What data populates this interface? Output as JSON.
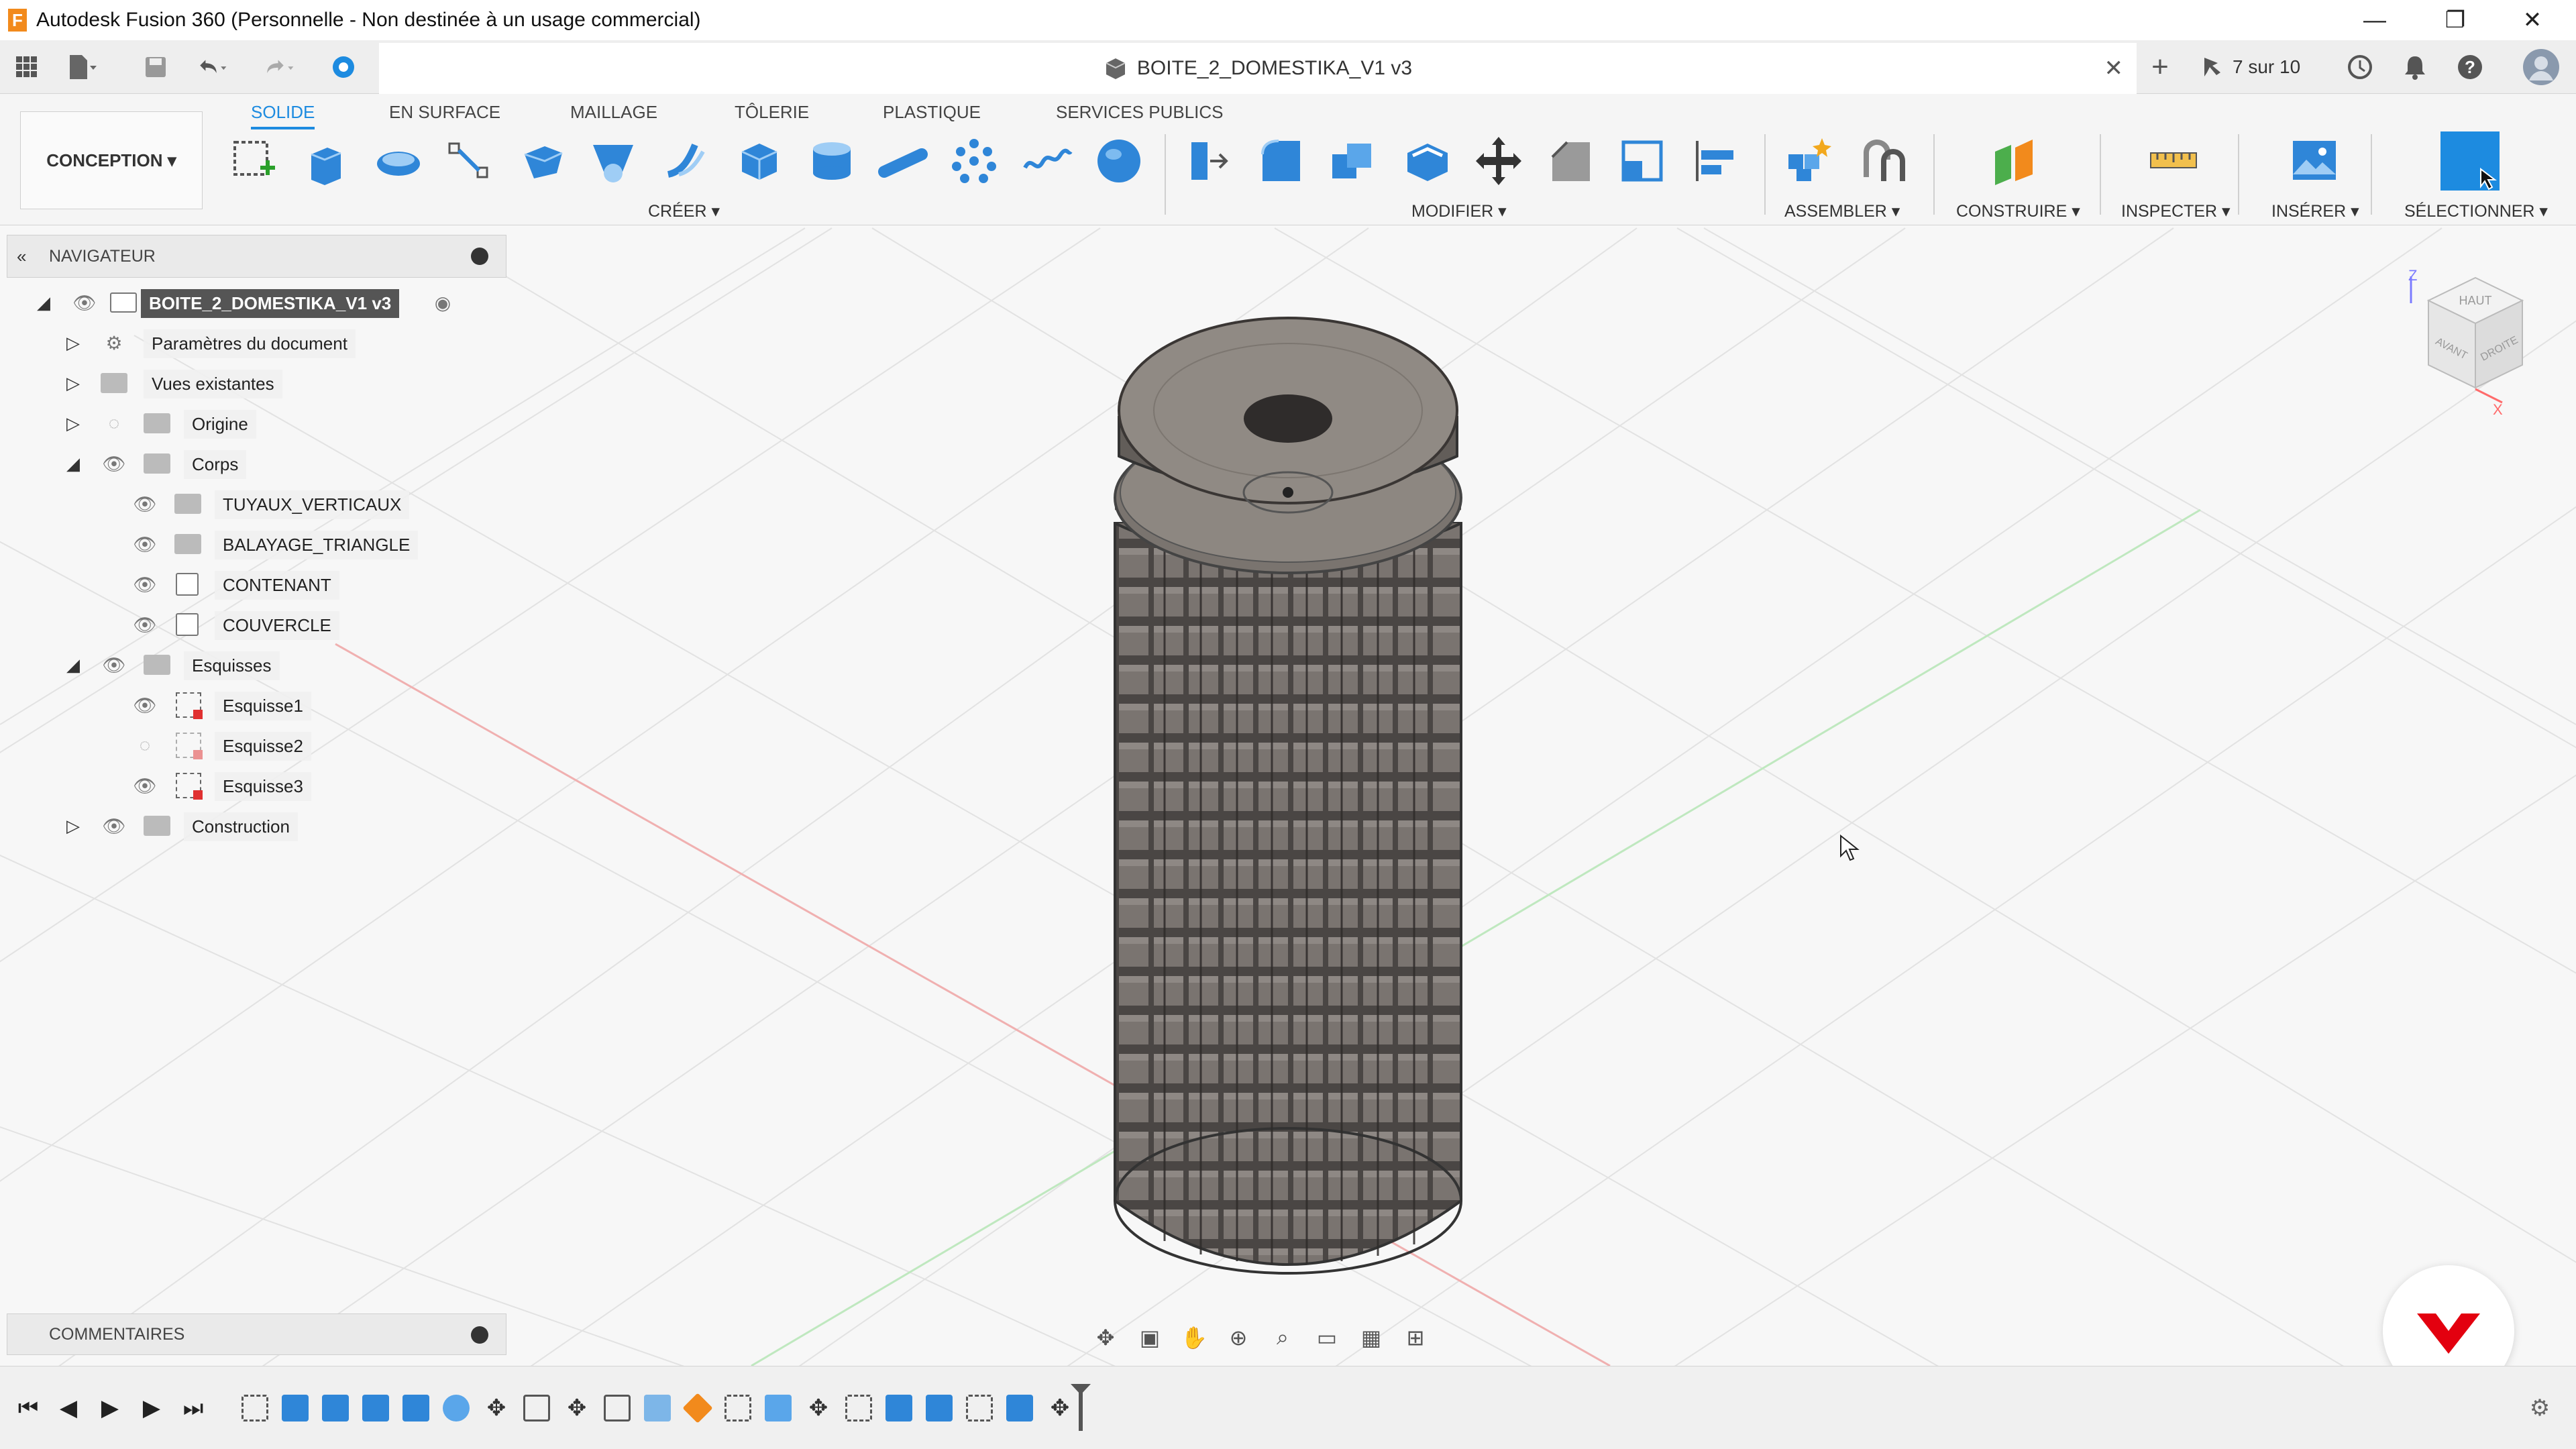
{
  "window": {
    "title": "Autodesk Fusion 360 (Personnelle - Non destinée à un usage commercial)",
    "minimize": "—",
    "restore": "❐",
    "close": "✕"
  },
  "doc_tab": {
    "name": "BOITE_2_DOMESTIKA_V1 v3",
    "close": "✕"
  },
  "tabbar": {
    "counter": "7 sur 10",
    "plus": "+"
  },
  "workspace": {
    "label": "CONCEPTION ▾"
  },
  "tabs": [
    "SOLIDE",
    "EN SURFACE",
    "MAILLAGE",
    "TÔLERIE",
    "PLASTIQUE",
    "SERVICES PUBLICS"
  ],
  "groups": {
    "creer": "CRÉER ▾",
    "modifier": "MODIFIER ▾",
    "assembler": "ASSEMBLER ▾",
    "construire": "CONSTRUIRE ▾",
    "inspecter": "INSPECTER ▾",
    "inserer": "INSÉRER ▾",
    "selectionner": "SÉLECTIONNER ▾"
  },
  "navigator": {
    "title": "NAVIGATEUR",
    "root": "BOITE_2_DOMESTIKA_V1 v3",
    "items": [
      {
        "label": "Paramètres du document",
        "level": 1
      },
      {
        "label": "Vues existantes",
        "level": 1
      },
      {
        "label": "Origine",
        "level": 1
      },
      {
        "label": "Corps",
        "level": 1
      },
      {
        "label": "TUYAUX_VERTICAUX",
        "level": 2
      },
      {
        "label": "BALAYAGE_TRIANGLE",
        "level": 2
      },
      {
        "label": "CONTENANT",
        "level": 2
      },
      {
        "label": "COUVERCLE",
        "level": 2
      },
      {
        "label": "Esquisses",
        "level": 1
      },
      {
        "label": "Esquisse1",
        "level": 2
      },
      {
        "label": "Esquisse2",
        "level": 2
      },
      {
        "label": "Esquisse3",
        "level": 2
      },
      {
        "label": "Construction",
        "level": 1
      }
    ]
  },
  "comments": {
    "title": "COMMENTAIRES"
  },
  "viewcube": {
    "top": "HAUT",
    "front": "AVANT",
    "right": "DROITE",
    "axis_z": "Z",
    "axis_x": "X"
  },
  "colors": {
    "accent": "#1d8be0",
    "model_fill": "#6f6a66",
    "grid_line": "#e3e3e3",
    "axis_red": "#e8a0a0",
    "axis_green": "#a8e3a8",
    "domestika": "#e3000f"
  }
}
